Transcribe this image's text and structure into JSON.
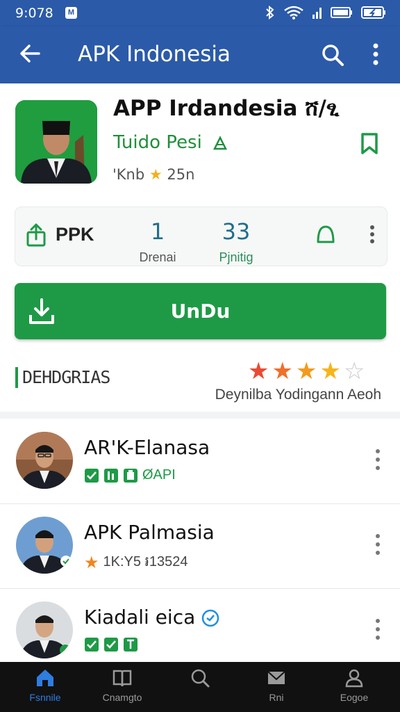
{
  "status_bar": {
    "time": "9:078",
    "notif_badge": "M"
  },
  "app_bar": {
    "title": "APK Indonesia"
  },
  "app": {
    "name": "APP Irdandesia ሸ/ፂ",
    "developer": "Tuido Pesi",
    "meta_prefix": "'Knb",
    "meta_star": "★",
    "meta_count": "25n"
  },
  "stats": {
    "share_label": "PPK",
    "stat1": {
      "value": "1",
      "label": "Drenai"
    },
    "stat2": {
      "value": "33",
      "label": "Pjnitig"
    }
  },
  "download": {
    "label": "UnDu"
  },
  "category": {
    "label": "DEHDGRIAS",
    "rating_caption": "Deynilba Yodingann Aeoh",
    "rating_stars": 4,
    "rating_max": 5
  },
  "list": [
    {
      "name": "AR'K-Elanasa",
      "sub_text": "ØAPI"
    },
    {
      "name": "APK Palmasia",
      "sub_text": "1K:Y5 ៛13524"
    },
    {
      "name": "Kiadali eica",
      "sub_text": ""
    }
  ],
  "tabs": [
    {
      "label": "Fsnnile"
    },
    {
      "label": "Cnamgto"
    },
    {
      "label": ""
    },
    {
      "label": "Rni"
    },
    {
      "label": "Eogoe"
    }
  ],
  "colors": {
    "primary": "#2b5aa8",
    "accent_green": "#1e9a46",
    "tab_active": "#2f7de1"
  }
}
